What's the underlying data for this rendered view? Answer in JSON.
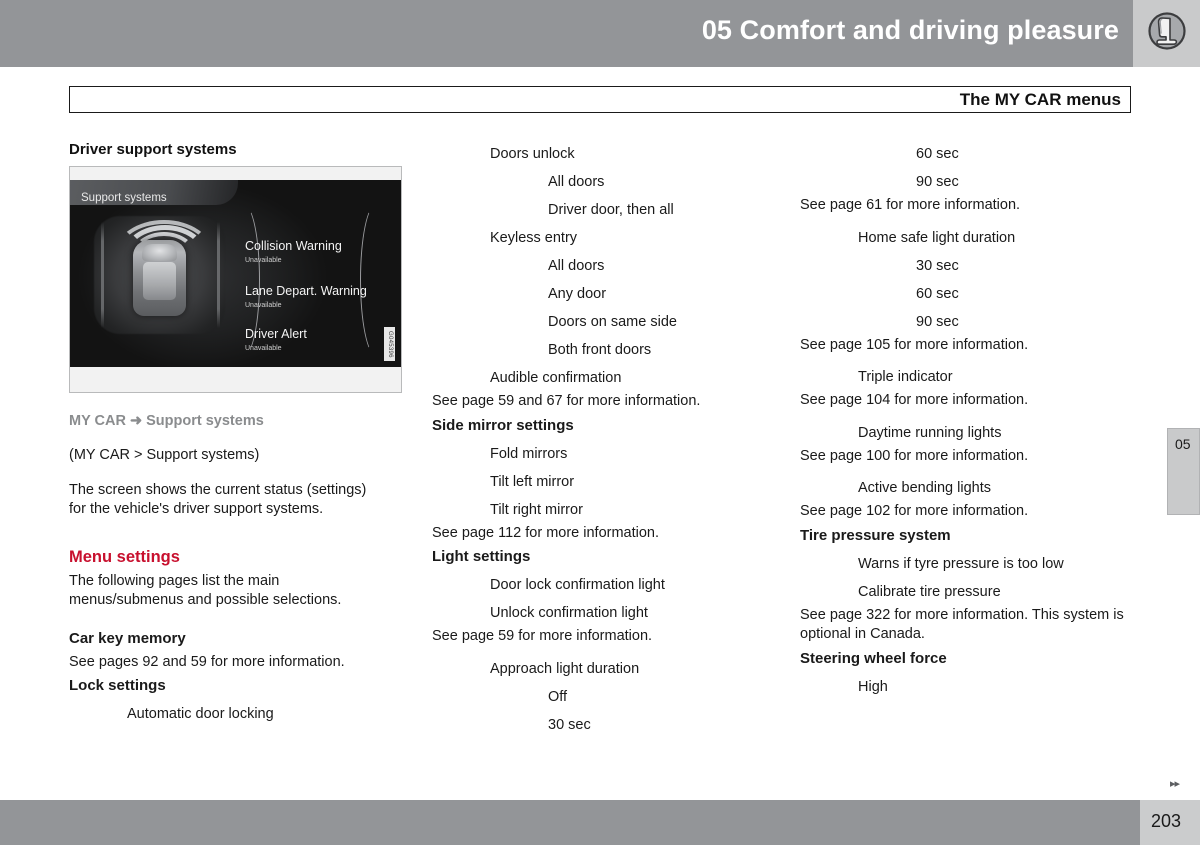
{
  "header": {
    "title": "05 Comfort and driving pleasure",
    "icon": "car-seat-icon"
  },
  "section": {
    "label": "The MY CAR menus"
  },
  "left_column": {
    "heading": "Driver support systems",
    "figure": {
      "screen_tab": "Support systems",
      "items": [
        {
          "title": "Collision Warning",
          "status": "Unavailable"
        },
        {
          "title": "Lane Depart. Warning",
          "status": "Unavailable"
        },
        {
          "title": "Driver Alert",
          "status": "Unavailable"
        }
      ],
      "code": "G045396"
    },
    "breadcrumb": "MY CAR ➜ Support systems",
    "path_note": "(MY CAR > Support systems)",
    "description": "The screen shows the current status (settings) for the vehicle's driver support systems.",
    "menu_settings_heading": "Menu settings",
    "menu_settings_text": "The following pages list the main menus/submenus and possible selections.",
    "entries": [
      {
        "text": "Car key memory",
        "level": 0,
        "style": "bold"
      },
      {
        "text": "See pages 92 and 59 for more information.",
        "level": 0,
        "style": "ref"
      },
      {
        "text": "Lock settings",
        "level": 0,
        "style": "bold"
      },
      {
        "text": "Automatic door locking",
        "level": 1,
        "style": "normal"
      }
    ]
  },
  "middle_column": {
    "entries": [
      {
        "text": "Doors unlock",
        "level": 1,
        "style": "normal"
      },
      {
        "text": "All doors",
        "level": 2,
        "style": "normal"
      },
      {
        "text": "Driver door, then all",
        "level": 2,
        "style": "normal"
      },
      {
        "text": "Keyless entry",
        "level": 1,
        "style": "normal"
      },
      {
        "text": "All doors",
        "level": 2,
        "style": "normal"
      },
      {
        "text": "Any door",
        "level": 2,
        "style": "normal"
      },
      {
        "text": "Doors on same side",
        "level": 2,
        "style": "normal"
      },
      {
        "text": "Both front doors",
        "level": 2,
        "style": "normal"
      },
      {
        "text": "Audible confirmation",
        "level": 1,
        "style": "normal"
      },
      {
        "text": "See page 59 and 67 for more information.",
        "level": 0,
        "style": "ref"
      },
      {
        "text": "Side mirror settings",
        "level": 0,
        "style": "bold"
      },
      {
        "text": "Fold mirrors",
        "level": 1,
        "style": "normal"
      },
      {
        "text": "Tilt left mirror",
        "level": 1,
        "style": "normal"
      },
      {
        "text": "Tilt right mirror",
        "level": 1,
        "style": "normal"
      },
      {
        "text": "See page 112 for more information.",
        "level": 0,
        "style": "ref"
      },
      {
        "text": "Light settings",
        "level": 0,
        "style": "bold"
      },
      {
        "text": "Door lock confirmation light",
        "level": 1,
        "style": "normal"
      },
      {
        "text": "Unlock confirmation light",
        "level": 1,
        "style": "normal"
      },
      {
        "text": "See page 59 for more information.",
        "level": 0,
        "style": "ref"
      },
      {
        "text": "Approach light duration",
        "level": 1,
        "style": "normal-gap"
      },
      {
        "text": "Off",
        "level": 2,
        "style": "normal"
      },
      {
        "text": "30 sec",
        "level": 2,
        "style": "normal"
      }
    ]
  },
  "right_column": {
    "entries": [
      {
        "text": "60 sec",
        "level": 2,
        "style": "normal"
      },
      {
        "text": "90 sec",
        "level": 2,
        "style": "normal"
      },
      {
        "text": "See page 61 for more information.",
        "level": 0,
        "style": "ref"
      },
      {
        "text": "Home safe light duration",
        "level": 1,
        "style": "normal-gap"
      },
      {
        "text": "30 sec",
        "level": 2,
        "style": "normal"
      },
      {
        "text": "60 sec",
        "level": 2,
        "style": "normal"
      },
      {
        "text": "90 sec",
        "level": 2,
        "style": "normal"
      },
      {
        "text": "See page 105 for more information.",
        "level": 0,
        "style": "ref"
      },
      {
        "text": "Triple indicator",
        "level": 1,
        "style": "normal-gap"
      },
      {
        "text": "See page 104 for more information.",
        "level": 0,
        "style": "ref"
      },
      {
        "text": "Daytime running lights",
        "level": 1,
        "style": "normal-gap"
      },
      {
        "text": "See page 100 for more information.",
        "level": 0,
        "style": "ref"
      },
      {
        "text": "Active bending lights",
        "level": 1,
        "style": "normal-gap"
      },
      {
        "text": "See page 102 for more information.",
        "level": 0,
        "style": "ref"
      },
      {
        "text": "Tire pressure system",
        "level": 0,
        "style": "bold"
      },
      {
        "text": "Warns if tyre pressure is too low",
        "level": 1,
        "style": "normal"
      },
      {
        "text": "Calibrate tire pressure",
        "level": 1,
        "style": "normal"
      },
      {
        "text": "See page 322 for more information. This system is optional in Canada.",
        "level": 0,
        "style": "ref"
      },
      {
        "text": "Steering wheel force",
        "level": 0,
        "style": "bold"
      },
      {
        "text": "High",
        "level": 1,
        "style": "normal"
      }
    ]
  },
  "side_tab": {
    "label": "05"
  },
  "footer": {
    "arrows": "▸▸",
    "page_number": "203"
  },
  "colors": {
    "header_gray": "#939598",
    "accent_red": "#c8102e",
    "breadcrumb_gray": "#8a8c8e",
    "tab_gray": "#c9cacb"
  }
}
